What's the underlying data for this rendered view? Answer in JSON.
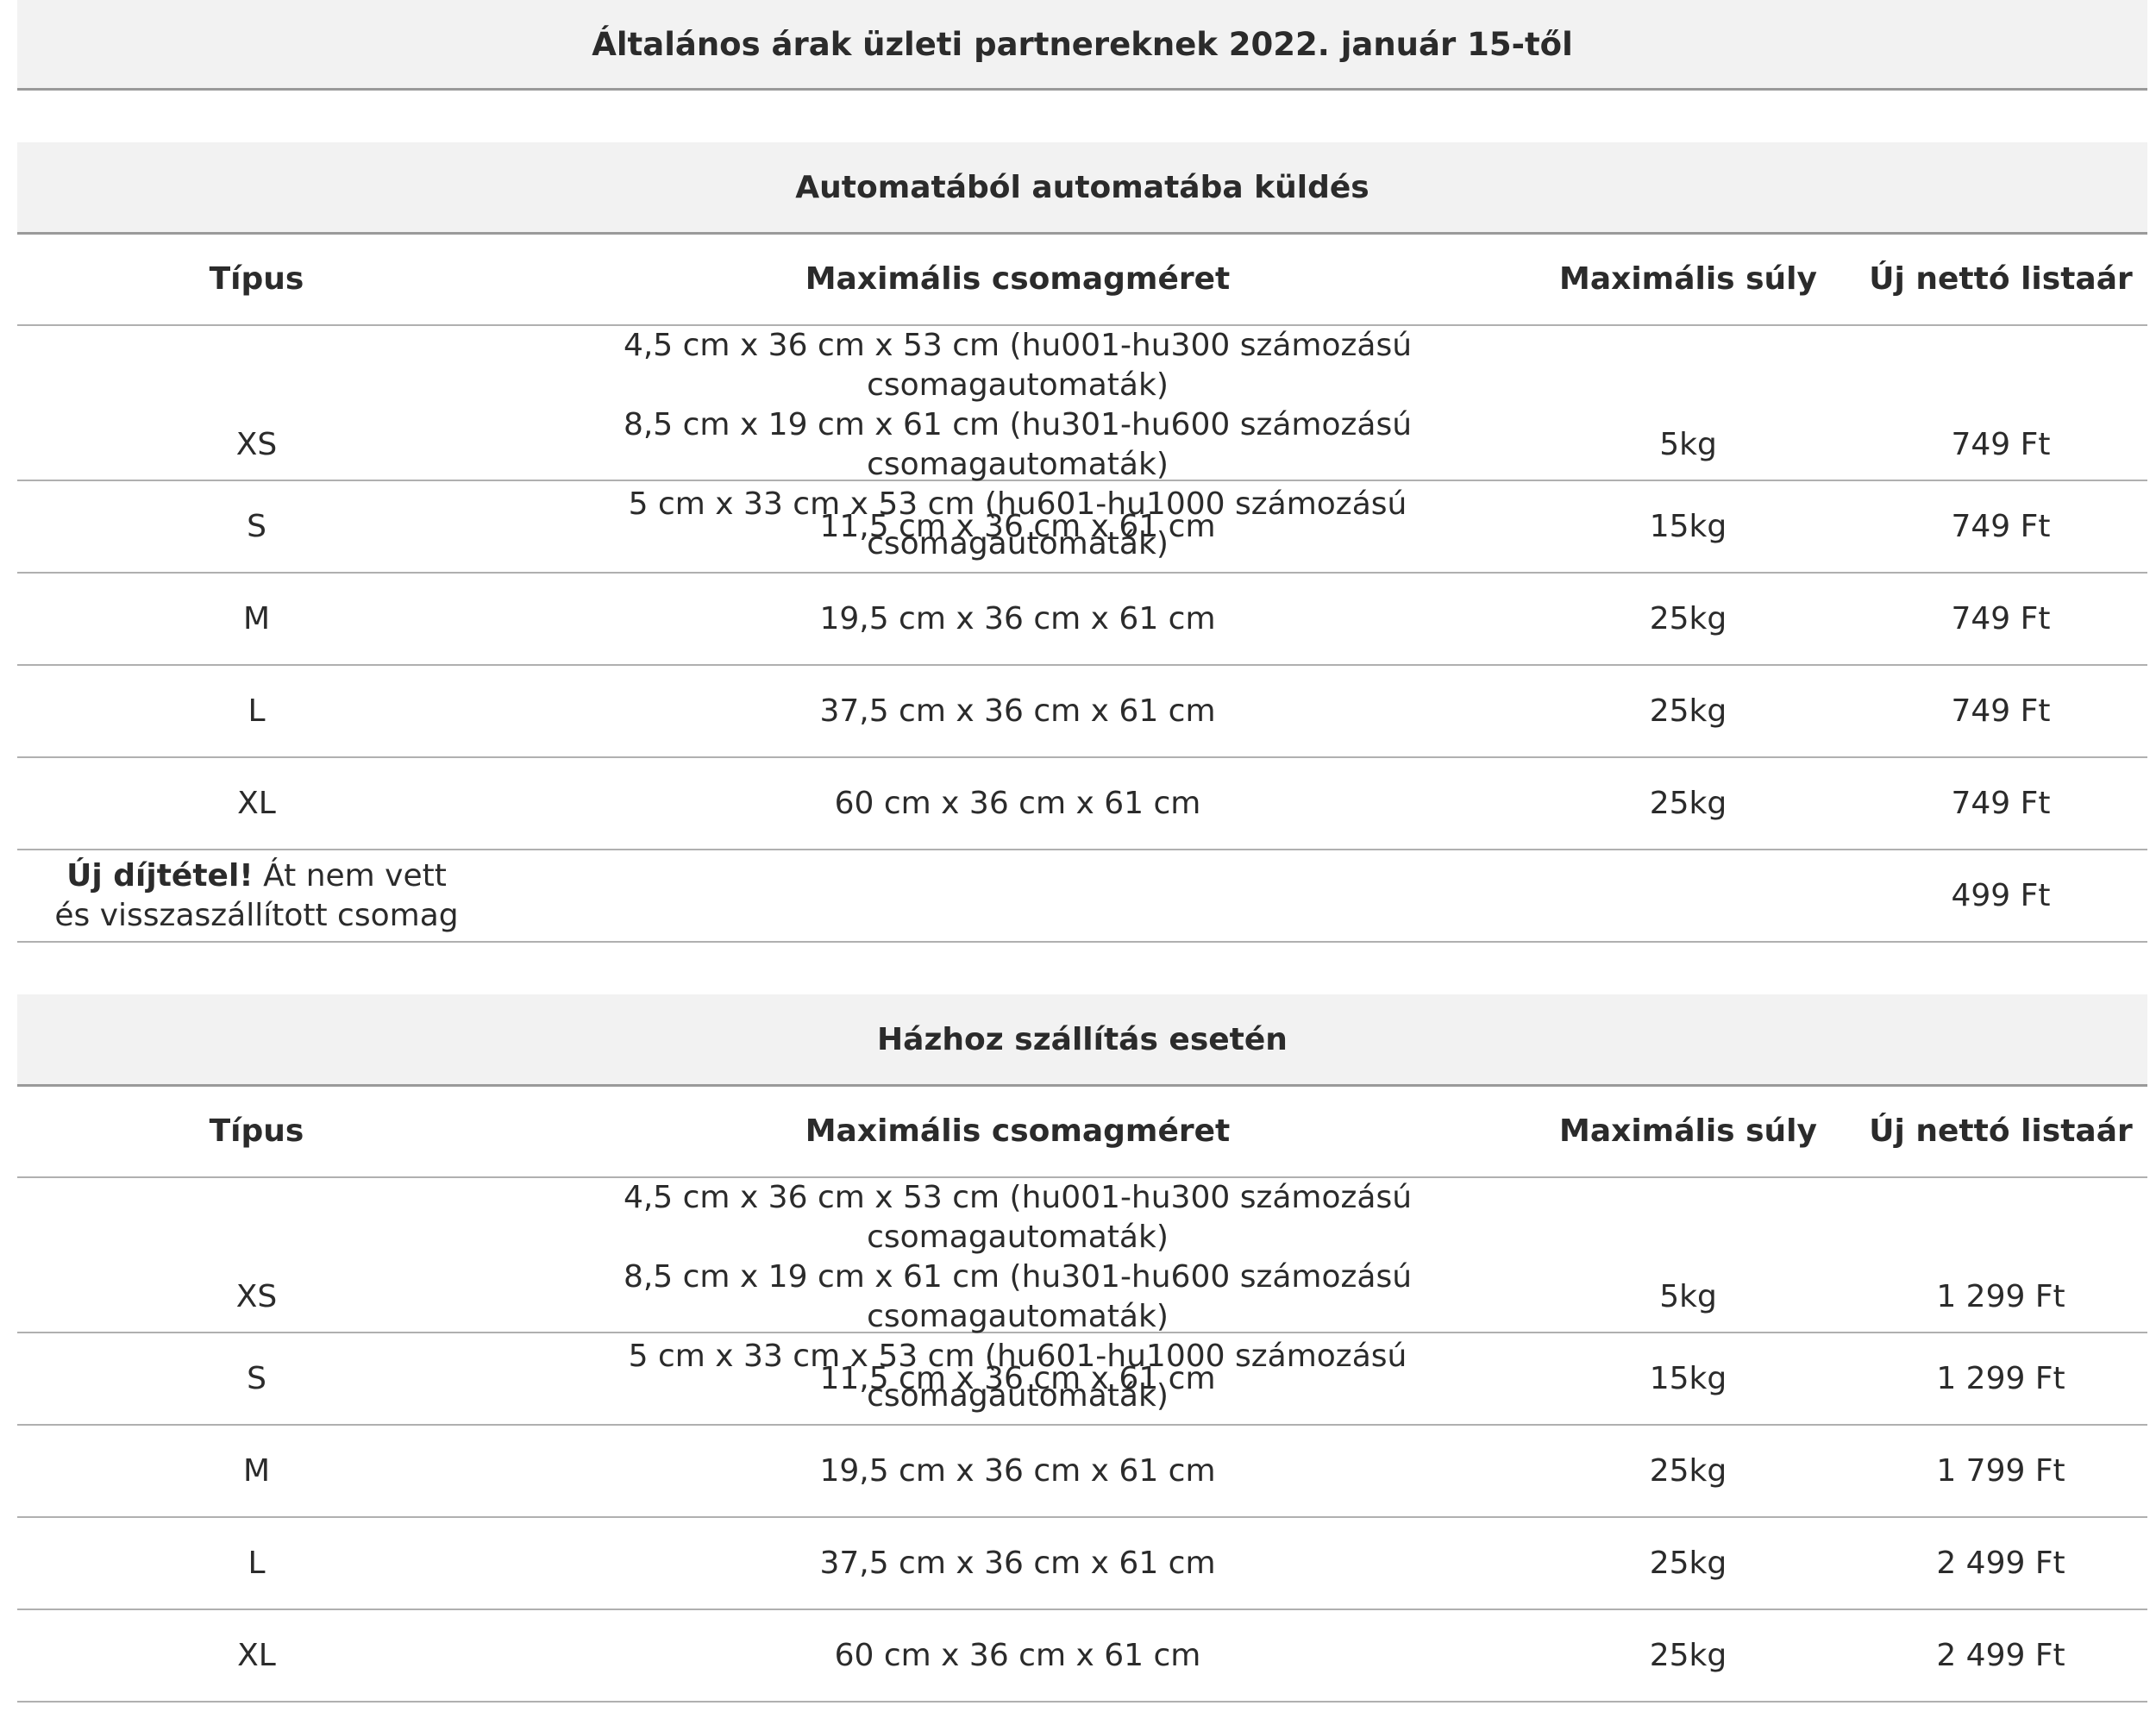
{
  "title": "Általános árak üzleti partnereknek 2022. január 15-től",
  "sections": [
    {
      "title": "Automatából automatába küldés",
      "headers": [
        "Típus",
        "Maximális csomagméret",
        "Maximális súly",
        "Új nettó listaár"
      ],
      "rows": [
        {
          "type": "XS",
          "size_lines": [
            "4,5 cm x 36 cm x 53 cm (hu001-hu300 számozású csomagautomaták)",
            "8,5 cm x 19 cm x 61 cm (hu301-hu600 számozású csomagautomaták)",
            "5 cm x 33 cm x 53 cm (hu601-hu1000 számozású csomagautomaták)"
          ],
          "weight": "5kg",
          "price": "749 Ft"
        },
        {
          "type": "S",
          "size": "11,5 cm x 36 cm x 61 cm",
          "weight": "15kg",
          "price": "749 Ft"
        },
        {
          "type": "M",
          "size": "19,5 cm x 36 cm x 61 cm",
          "weight": "25kg",
          "price": "749 Ft"
        },
        {
          "type": "L",
          "size": "37,5 cm x 36 cm x 61 cm",
          "weight": "25kg",
          "price": "749 Ft"
        },
        {
          "type": "XL",
          "size": "60 cm x 36 cm x 61 cm",
          "weight": "25kg",
          "price": "749 Ft"
        }
      ],
      "extra_row": {
        "label_bold": "Új díjtétel!",
        "label_rest_line1": " Át nem vett",
        "label_line2": "és visszaszállított csomag",
        "price": "499 Ft"
      }
    },
    {
      "title": "Házhoz szállítás esetén",
      "headers": [
        "Típus",
        "Maximális csomagméret",
        "Maximális súly",
        "Új nettó listaár"
      ],
      "rows": [
        {
          "type": "XS",
          "size_lines": [
            "4,5 cm x 36 cm x 53 cm (hu001-hu300 számozású csomagautomaták)",
            "8,5 cm x 19 cm x 61 cm (hu301-hu600 számozású csomagautomaták)",
            "5 cm x 33 cm x 53 cm (hu601-hu1000 számozású csomagautomaták)"
          ],
          "weight": "5kg",
          "price": "1 299 Ft"
        },
        {
          "type": "S",
          "size": "11,5 cm x 36 cm x 61 cm",
          "weight": "15kg",
          "price": "1 299 Ft"
        },
        {
          "type": "M",
          "size": "19,5 cm x 36 cm x 61 cm",
          "weight": "25kg",
          "price": "1 799 Ft"
        },
        {
          "type": "L",
          "size": "37,5 cm x 36 cm x 61 cm",
          "weight": "25kg",
          "price": "2 499 Ft"
        },
        {
          "type": "XL",
          "size": "60 cm x 36 cm x 61 cm",
          "weight": "25kg",
          "price": "2 499 Ft"
        }
      ]
    }
  ]
}
